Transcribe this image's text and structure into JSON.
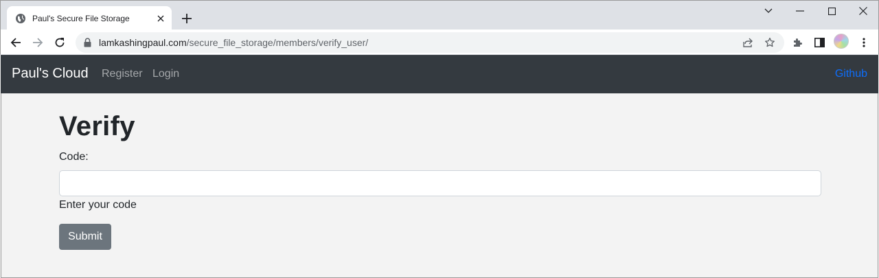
{
  "browser": {
    "tab_title": "Paul's Secure File Storage",
    "url_host": "lamkashingpaul.com",
    "url_path": "/secure_file_storage/members/verify_user/",
    "icons": [
      "globe-icon",
      "close-icon",
      "plus-icon",
      "chevron-down-icon",
      "minimize-icon",
      "maximize-icon",
      "close-icon",
      "back-icon",
      "forward-icon",
      "reload-icon",
      "lock-icon",
      "share-icon",
      "star-icon",
      "extensions-icon",
      "side-panel-icon",
      "menu-icon"
    ]
  },
  "navbar": {
    "brand": "Paul's Cloud",
    "links": [
      "Register",
      "Login"
    ],
    "github": "Github",
    "bg_color": "#343a40",
    "link_color": "#0d6efd"
  },
  "form": {
    "title": "Verify",
    "code_label": "Code:",
    "code_value": "",
    "help_text": "Enter your code",
    "submit_label": "Submit",
    "button_color": "#6c757d"
  }
}
